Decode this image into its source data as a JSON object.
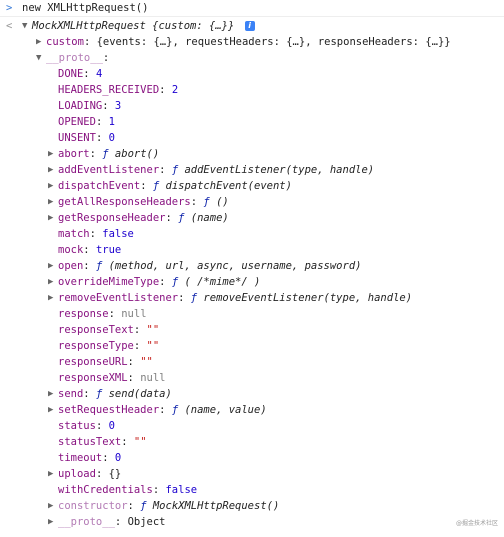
{
  "input": {
    "prompt": "<",
    "command": "new XMLHttpRequest()"
  },
  "result": {
    "class_name": "MockXMLHttpRequest",
    "summary": "{custom: {…}}",
    "custom": {
      "key": "custom",
      "value": "{events: {…}, requestHeaders: {…}, responseHeaders: {…}}"
    },
    "proto": {
      "key": "__proto__",
      "value": ""
    },
    "props": [
      {
        "key": "DONE",
        "value": "4",
        "type": "num"
      },
      {
        "key": "HEADERS_RECEIVED",
        "value": "2",
        "type": "num"
      },
      {
        "key": "LOADING",
        "value": "3",
        "type": "num"
      },
      {
        "key": "OPENED",
        "value": "1",
        "type": "num"
      },
      {
        "key": "UNSENT",
        "value": "0",
        "type": "num"
      },
      {
        "key": "abort",
        "value": "abort()",
        "type": "fn",
        "expandable": true
      },
      {
        "key": "addEventListener",
        "value": "addEventListener(type, handle)",
        "type": "fn",
        "expandable": true
      },
      {
        "key": "dispatchEvent",
        "value": "dispatchEvent(event)",
        "type": "fn",
        "expandable": true
      },
      {
        "key": "getAllResponseHeaders",
        "value": "()",
        "type": "fn",
        "expandable": true
      },
      {
        "key": "getResponseHeader",
        "value": "(name)",
        "type": "fn",
        "expandable": true
      },
      {
        "key": "match",
        "value": "false",
        "type": "num"
      },
      {
        "key": "mock",
        "value": "true",
        "type": "num"
      },
      {
        "key": "open",
        "value": "(method, url, async, username, password)",
        "type": "fn",
        "expandable": true
      },
      {
        "key": "overrideMimeType",
        "value": "( /*mime*/ )",
        "type": "fn",
        "expandable": true
      },
      {
        "key": "removeEventListener",
        "value": "removeEventListener(type, handle)",
        "type": "fn",
        "expandable": true
      },
      {
        "key": "response",
        "value": "null",
        "type": "nul"
      },
      {
        "key": "responseText",
        "value": "\"\"",
        "type": "str"
      },
      {
        "key": "responseType",
        "value": "\"\"",
        "type": "str"
      },
      {
        "key": "responseURL",
        "value": "\"\"",
        "type": "str"
      },
      {
        "key": "responseXML",
        "value": "null",
        "type": "nul"
      },
      {
        "key": "send",
        "value": "send(data)",
        "type": "fn",
        "expandable": true
      },
      {
        "key": "setRequestHeader",
        "value": "(name, value)",
        "type": "fn",
        "expandable": true
      },
      {
        "key": "status",
        "value": "0",
        "type": "num"
      },
      {
        "key": "statusText",
        "value": "\"\"",
        "type": "str"
      },
      {
        "key": "timeout",
        "value": "0",
        "type": "num"
      },
      {
        "key": "upload",
        "value": "{}",
        "type": "obj",
        "expandable": true
      },
      {
        "key": "withCredentials",
        "value": "false",
        "type": "num"
      },
      {
        "key": "constructor",
        "value": "MockXMLHttpRequest()",
        "type": "fn",
        "expandable": true,
        "dim": true
      },
      {
        "key": "__proto__",
        "value": "Object",
        "type": "obj",
        "expandable": true,
        "dim": true
      }
    ],
    "fn_symbol": "ƒ"
  },
  "watermark": "@掘金技术社区",
  "icons": {
    "expanded": "triangle-down-icon",
    "collapsed": "triangle-right-icon",
    "info": "info-icon"
  }
}
